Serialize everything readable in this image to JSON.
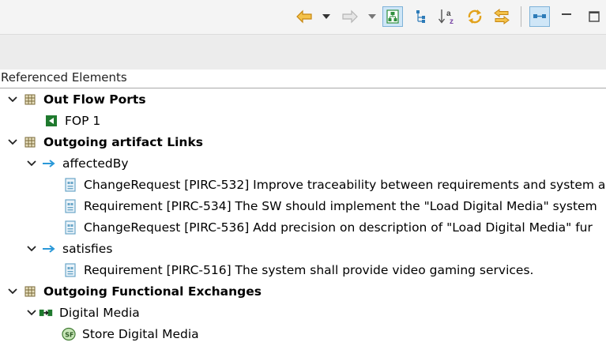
{
  "panel": {
    "title": "Referenced Elements"
  },
  "toolbar": {
    "icons": [
      "back-arrow-icon",
      "back-dropdown-icon",
      "forward-arrow-icon",
      "forward-dropdown-icon",
      "show-hierarchy-icon",
      "tree-icon",
      "sort-az-icon",
      "refresh-icon",
      "swap-icon",
      "link-layout-icon",
      "minimize-icon",
      "maximize-icon"
    ]
  },
  "tree": {
    "group1": {
      "label": "Out Flow Ports"
    },
    "fop1": {
      "label": "FOP 1"
    },
    "group2": {
      "label": "Outgoing artifact Links"
    },
    "affectedBy": {
      "label": "affectedBy"
    },
    "item1": {
      "label": "ChangeRequest [PIRC-532] Improve traceability between requirements and system a"
    },
    "item2": {
      "label": "Requirement [PIRC-534] The SW should implement the \"Load Digital Media\" system"
    },
    "item3": {
      "label": "ChangeRequest [PIRC-536] Add precision on description of \"Load Digital Media\" fur"
    },
    "satisfies": {
      "label": "satisfies"
    },
    "item4": {
      "label": "Requirement [PIRC-516] The system shall provide video gaming services."
    },
    "group3": {
      "label": "Outgoing Functional Exchanges"
    },
    "digitalMedia": {
      "label": "Digital Media"
    },
    "storeDigitalMedia": {
      "label": "Store Digital Media",
      "badge": "SF"
    }
  },
  "colors": {
    "toolbar_bg": "#f4f4f4",
    "arrow_orange": "#e7a31c",
    "green_port": "#1f7a2e",
    "link_blue": "#2a98d8",
    "doc_blue": "#6aa6c8"
  }
}
